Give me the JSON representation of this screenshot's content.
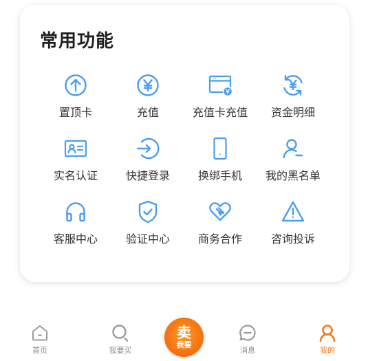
{
  "card": {
    "title": "常用功能",
    "items": [
      {
        "label": "置顶卡",
        "icon": "arrow-up-circle-icon"
      },
      {
        "label": "充值",
        "icon": "yen-circle-icon"
      },
      {
        "label": "充值卡充值",
        "icon": "card-yen-icon"
      },
      {
        "label": "资金明细",
        "icon": "yen-refresh-icon"
      },
      {
        "label": "实名认证",
        "icon": "id-card-icon"
      },
      {
        "label": "快捷登录",
        "icon": "login-icon"
      },
      {
        "label": "换绑手机",
        "icon": "phone-icon"
      },
      {
        "label": "我的黑名单",
        "icon": "user-minus-icon"
      },
      {
        "label": "客服中心",
        "icon": "headset-icon"
      },
      {
        "label": "验证中心",
        "icon": "shield-check-icon"
      },
      {
        "label": "商务合作",
        "icon": "handshake-heart-icon"
      },
      {
        "label": "咨询投诉",
        "icon": "warning-icon"
      }
    ]
  },
  "tabbar": {
    "home": "首页",
    "buy": "我要买",
    "sell_big": "卖",
    "sell_small": "我要",
    "messages": "消息",
    "mine": "我的"
  },
  "colors": {
    "accent": "#4a9df0",
    "active": "#f07b1a",
    "inactive": "#9a9a9a"
  }
}
